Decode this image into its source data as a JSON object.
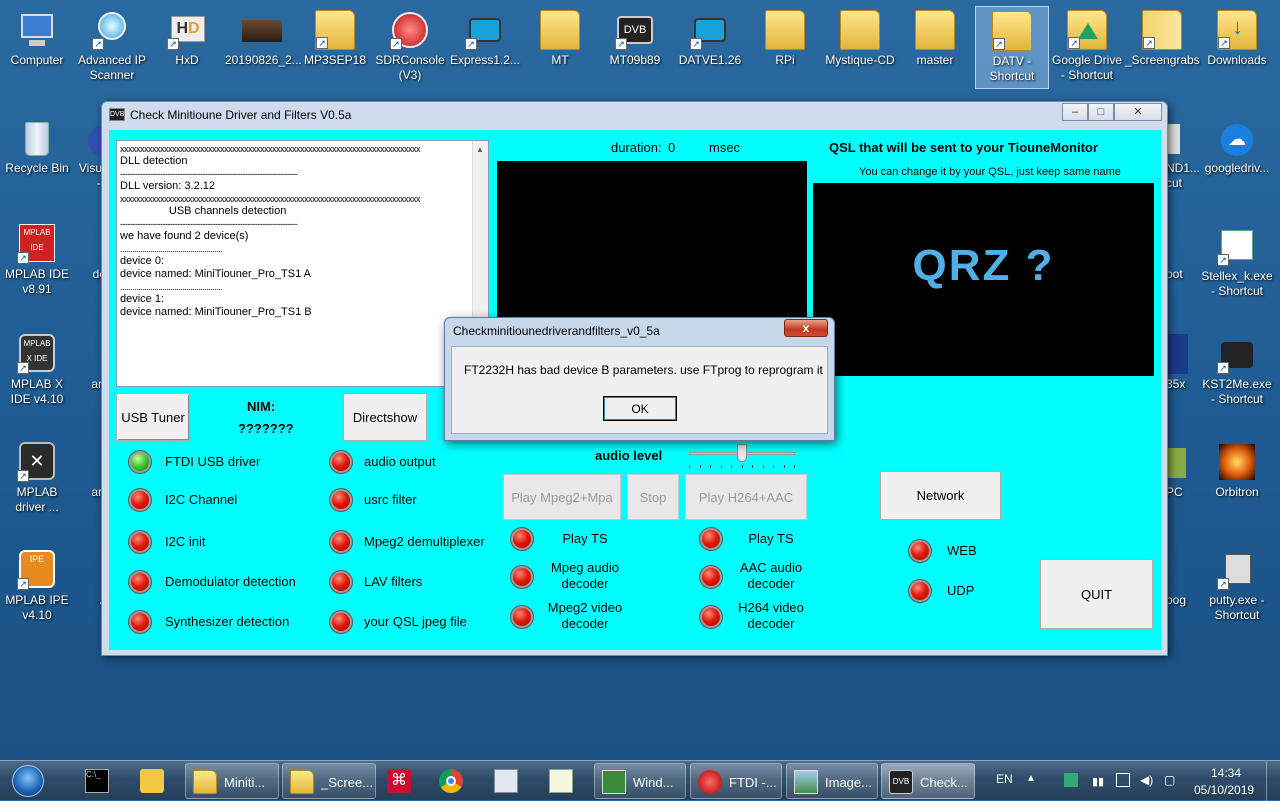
{
  "desktop": {
    "icons": [
      {
        "label": "Computer",
        "icon": "computer-icon"
      },
      {
        "label": "Advanced IP Scanner",
        "icon": "network-scanner-icon"
      },
      {
        "label": "HxD",
        "icon": "hxd-icon"
      },
      {
        "label": "20190826_2...",
        "icon": "image-file-icon"
      },
      {
        "label": "MP3SEP18",
        "icon": "folder-icon"
      },
      {
        "label": "SDRConsole (V3)",
        "icon": "sdr-console-icon"
      },
      {
        "label": "Express1.2...",
        "icon": "tv-icon"
      },
      {
        "label": "MT",
        "icon": "folder-icon"
      },
      {
        "label": "MT09b89",
        "icon": "dvb-tv-icon"
      },
      {
        "label": "DATVE1.26",
        "icon": "tv-icon"
      },
      {
        "label": "RPi",
        "icon": "folder-icon"
      },
      {
        "label": "Mystique-CD",
        "icon": "folder-icon"
      },
      {
        "label": "master",
        "icon": "folder-icon"
      },
      {
        "label": "DATV - Shortcut",
        "icon": "folder-icon"
      },
      {
        "label": "Google Drive - Shortcut",
        "icon": "google-drive-icon"
      },
      {
        "label": "_Screengrabs",
        "icon": "folder-icon"
      },
      {
        "label": "Downloads",
        "icon": "downloads-folder-icon"
      },
      {
        "label": "Recycle Bin",
        "icon": "recycle-bin-icon"
      },
      {
        "label": "Visu... - S",
        "icon": "app-icon"
      },
      {
        "label": "googledriv...",
        "icon": "cloud-upload-icon"
      },
      {
        "label": "ND1... cut",
        "icon": "app-icon"
      },
      {
        "label": "MPLAB IDE v8.91",
        "icon": "mplab-ide-icon"
      },
      {
        "label": "des",
        "icon": "app-icon"
      },
      {
        "label": "oot",
        "icon": "app-icon"
      },
      {
        "label": "Stellex_k.exe - Shortcut",
        "icon": "window-app-icon"
      },
      {
        "label": "MPLAB X IDE v4.10",
        "icon": "mplab-x-icon"
      },
      {
        "label": "ar 1",
        "icon": "app-icon"
      },
      {
        "label": "35x",
        "icon": "app-icon"
      },
      {
        "label": "KST2Me.exe - Shortcut",
        "icon": "typewriter-icon"
      },
      {
        "label": "MPLAB driver ...",
        "icon": "mplab-driver-icon"
      },
      {
        "label": "ar 1",
        "icon": "app-icon"
      },
      {
        "label": "PC",
        "icon": "app-icon"
      },
      {
        "label": "Orbitron",
        "icon": "orbitron-icon"
      },
      {
        "label": "MPLAB IPE v4.10",
        "icon": "mplab-ipe-icon"
      },
      {
        "label": "Ar",
        "icon": "app-icon"
      },
      {
        "label": "oog",
        "icon": "app-icon"
      },
      {
        "label": "putty.exe - Shortcut",
        "icon": "putty-icon"
      }
    ]
  },
  "main_window": {
    "title": "Check Minitioune Driver and Filters V0.5a",
    "log_lines": [
      "xxxxxxxxxxxxxxxxxxxxxxxxxxxxxxxxxxxxxxxxxxxxxxxxxxxxxxxxxxxxxxxxxxxxxxxxxxx",
      "DLL detection",
      "-----------------------------------------------------------------------",
      "DLL version: 3.2.12",
      "xxxxxxxxxxxxxxxxxxxxxxxxxxxxxxxxxxxxxxxxxxxxxxxxxxxxxxxxxxxxxxxxxxxxxxxxxxx",
      "                USB channels detection",
      "-----------------------------------------------------------------------",
      "we have found 2 device(s)",
      "...................................................",
      "device 0:",
      "device named: MiniTiouner_Pro_TS1 A",
      "...................................................",
      "device 1:",
      "device named: MiniTiouner_Pro_TS1 B"
    ],
    "duration_label": "duration:",
    "duration_value": "0",
    "duration_unit": "msec",
    "qsl_title": "QSL that will be sent to your TiouneMonitor",
    "qsl_subtitle": "You can change it by your QSL, just keep same name",
    "qsl_image_text": "QRZ ?",
    "usb_tuner_button": "USB Tuner",
    "nim_label": "NIM:",
    "nim_value": "???????",
    "directshow_button": "Directshow",
    "audio_level_label": "audio level",
    "audio_level_fraction": 0.5,
    "play_mpeg2_button": "Play Mpeg2+Mpa",
    "stop_button": "Stop",
    "play_h264_button": "Play H264+AAC",
    "network_button": "Network",
    "quit_button": "QUIT",
    "status_left": [
      {
        "label": "FTDI USB driver",
        "state": "green"
      },
      {
        "label": "I2C Channel",
        "state": "red"
      },
      {
        "label": "I2C init",
        "state": "red"
      },
      {
        "label": "Demodulator detection",
        "state": "red"
      },
      {
        "label": "Synthesizer detection",
        "state": "red"
      }
    ],
    "status_mid": [
      {
        "label": "audio output",
        "state": "red"
      },
      {
        "label": "usrc filter",
        "state": "red"
      },
      {
        "label": "Mpeg2 demultiplexer",
        "state": "red"
      },
      {
        "label": "LAV filters",
        "state": "red"
      },
      {
        "label": "your QSL jpeg file",
        "state": "red"
      }
    ],
    "status_play_mpeg": [
      {
        "label": "Play TS",
        "state": "red"
      },
      {
        "label": "Mpeg audio decoder",
        "state": "red"
      },
      {
        "label": "Mpeg2 video decoder",
        "state": "red"
      }
    ],
    "status_play_h264": [
      {
        "label": "Play TS",
        "state": "red"
      },
      {
        "label": "AAC audio decoder",
        "state": "red"
      },
      {
        "label": "H264 video decoder",
        "state": "red"
      }
    ],
    "status_network": [
      {
        "label": "WEB",
        "state": "red"
      },
      {
        "label": "UDP",
        "state": "red"
      }
    ],
    "colors": {
      "client_bg": "#00ffff",
      "led_red": "#e01a0a",
      "led_green": "#35c02a"
    }
  },
  "dialog": {
    "title": "Checkminitiounedriverandfilters_v0_5a",
    "message": "FT2232H has bad device B parameters. use FTprog to reprogram it",
    "ok_button": "OK",
    "close_glyph": "x"
  },
  "taskbar": {
    "items": [
      {
        "label": "",
        "icon": "start-orb-icon"
      },
      {
        "label": "",
        "icon": "cmd-icon"
      },
      {
        "label": "",
        "icon": "outlook-icon"
      },
      {
        "label": "Miniti...",
        "icon": "folder-icon"
      },
      {
        "label": "_Scree...",
        "icon": "folder-icon"
      },
      {
        "label": "",
        "icon": "acrobat-icon"
      },
      {
        "label": "",
        "icon": "chrome-icon"
      },
      {
        "label": "",
        "icon": "calculator-icon"
      },
      {
        "label": "",
        "icon": "notepad-plus-icon"
      },
      {
        "label": "Wind...",
        "icon": "window-app-icon"
      },
      {
        "label": "FTDI -...",
        "icon": "sdr-console-icon"
      },
      {
        "label": "Image...",
        "icon": "image-viewer-icon"
      },
      {
        "label": "Check...",
        "icon": "dvb-tv-icon"
      }
    ],
    "tray": {
      "lang": "EN",
      "time": "14:34",
      "date": "05/10/2019"
    }
  }
}
